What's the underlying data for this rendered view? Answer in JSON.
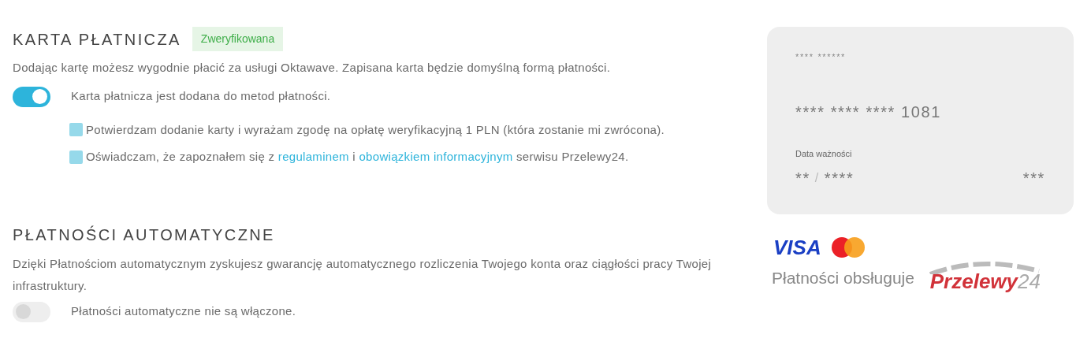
{
  "card_section": {
    "title": "KARTA PŁATNICZA",
    "badge": "Zweryfikowana",
    "description": "Dodając kartę możesz wygodnie płacić za usługi Oktawave. Zapisana karta będzie domyślną formą płatności.",
    "toggle": {
      "on": true,
      "label": "Karta płatnicza jest dodana do metod płatności."
    },
    "consents": [
      {
        "checked": true,
        "segments": [
          {
            "kind": "text",
            "text": "Potwierdzam dodanie karty i wyrażam zgodę na opłatę weryfikacyjną 1 PLN (która zostanie mi zwrócona)."
          }
        ]
      },
      {
        "checked": true,
        "segments": [
          {
            "kind": "text",
            "text": "Oświadczam, że zapoznałem się z "
          },
          {
            "kind": "link",
            "text": "regulaminem"
          },
          {
            "kind": "text",
            "text": " i "
          },
          {
            "kind": "link",
            "text": "obowiązkiem informacyjnym"
          },
          {
            "kind": "text",
            "text": " serwisu Przelewy24."
          }
        ]
      }
    ]
  },
  "auto_section": {
    "title": "PŁATNOŚCI AUTOMATYCZNE",
    "description": "Dzięki Płatnościom automatycznym zyskujesz gwarancję automatycznego rozliczenia Twojego konta oraz ciągłości pracy Twojej infrastruktury.",
    "toggle": {
      "on": false,
      "label": "Płatności automatyczne nie są włączone."
    }
  },
  "payment_card": {
    "holder": "**** ******",
    "number": "**** **** **** 1081",
    "expiry_label": "Data ważności",
    "expiry_month": "**",
    "expiry_separator": "/",
    "expiry_year": "****",
    "cvv": "***"
  },
  "providers": {
    "visa": "VISA",
    "caption": "Płatności obsługuje",
    "przelewy_name": "Przelewy",
    "przelewy_number": "24"
  }
}
